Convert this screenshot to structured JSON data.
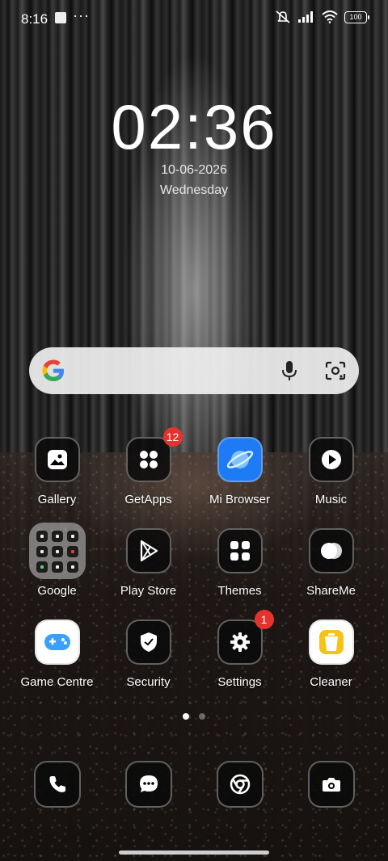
{
  "status_bar": {
    "time": "8:16",
    "notification_icons": [
      "square-icon",
      "more-dots-icon"
    ],
    "right_icons": [
      "silent-icon",
      "signal-icon",
      "wifi-icon",
      "battery-icon"
    ],
    "battery": "100"
  },
  "clock": {
    "time": "02:36",
    "date": "10-06-2026",
    "day": "Wednesday"
  },
  "search_bar": {
    "icons": [
      "google-g-icon",
      "mic-icon",
      "lens-icon"
    ]
  },
  "apps": [
    {
      "label": "Gallery",
      "icon": "gallery-icon"
    },
    {
      "label": "GetApps",
      "icon": "getapps-icon",
      "badge": "12"
    },
    {
      "label": "Mi Browser",
      "icon": "mi-browser-icon"
    },
    {
      "label": "Music",
      "icon": "music-icon"
    },
    {
      "label": "Google",
      "icon": "folder-icon"
    },
    {
      "label": "Play Store",
      "icon": "play-store-icon"
    },
    {
      "label": "Themes",
      "icon": "themes-icon"
    },
    {
      "label": "ShareMe",
      "icon": "shareme-icon"
    },
    {
      "label": "Game Centre",
      "icon": "game-centre-icon"
    },
    {
      "label": "Security",
      "icon": "security-icon"
    },
    {
      "label": "Settings",
      "icon": "settings-icon",
      "badge": "1"
    },
    {
      "label": "Cleaner",
      "icon": "cleaner-icon"
    }
  ],
  "pager": {
    "pages": 2,
    "current": 1
  },
  "dock": [
    "phone-icon",
    "messages-icon",
    "chrome-icon",
    "camera-icon"
  ],
  "colors": {
    "badge": "#e5322d",
    "browser_blue": "#1e7bf5",
    "game_blue": "#3aa0ff",
    "cleaner_yellow": "#f6c21a"
  }
}
